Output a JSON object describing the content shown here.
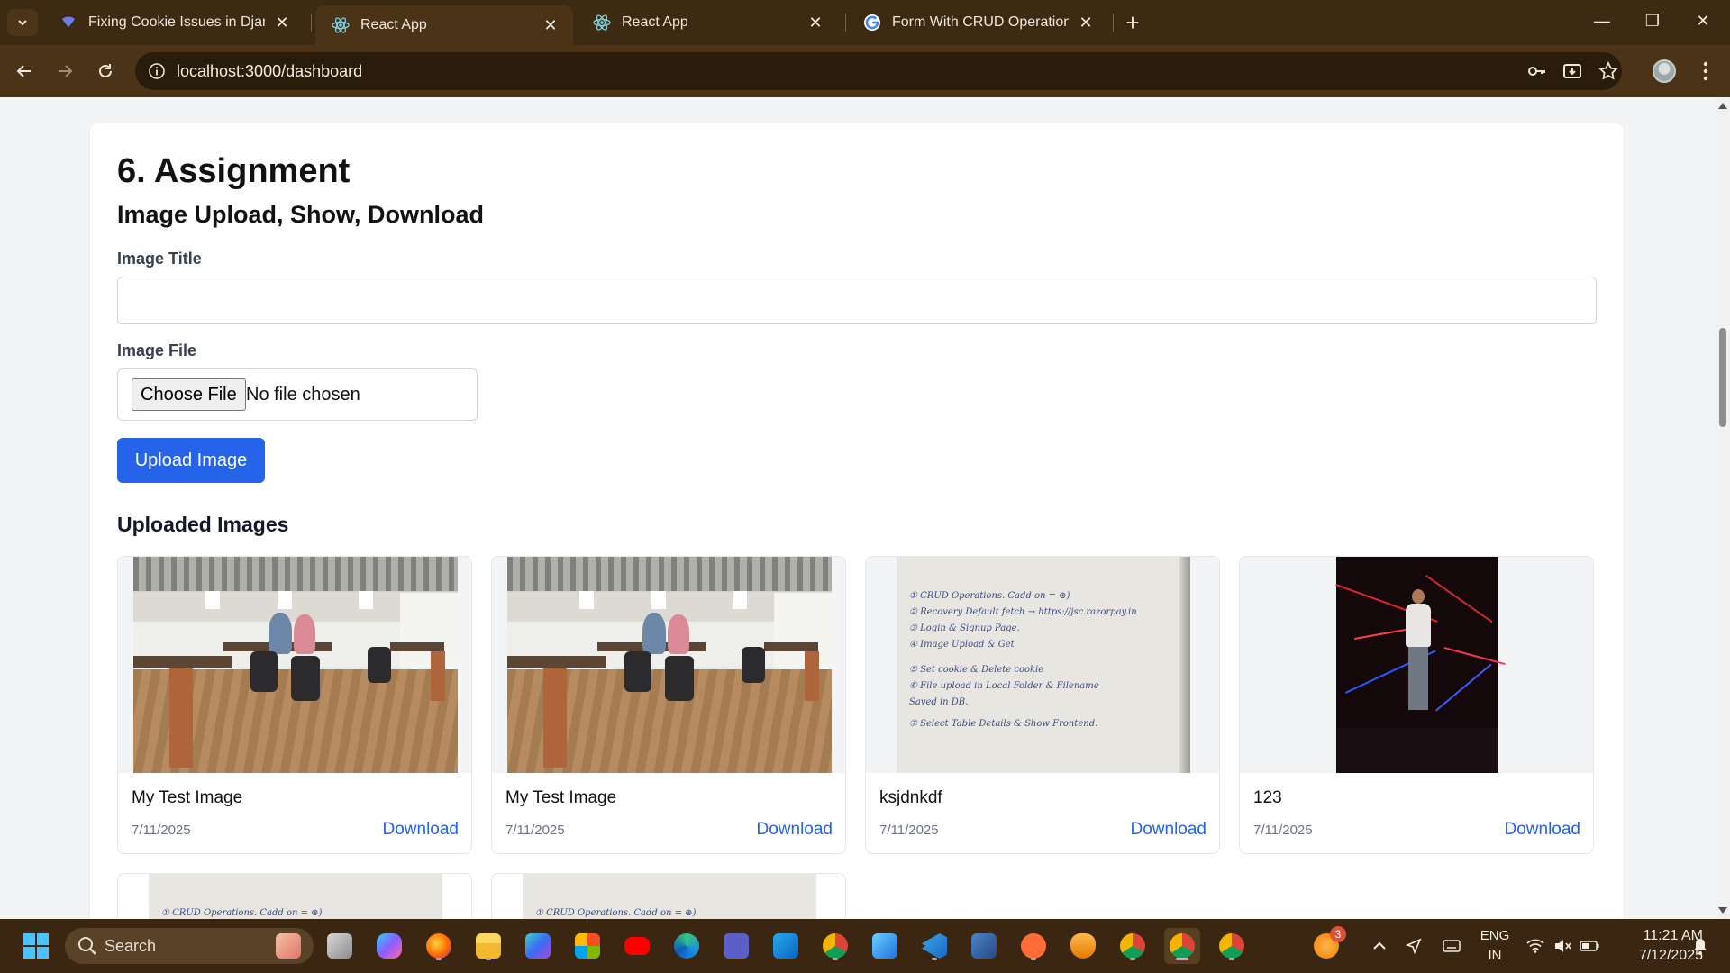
{
  "browser": {
    "tabs": [
      {
        "title": "Fixing Cookie Issues in Django",
        "icon": "claude-favicon",
        "active": false
      },
      {
        "title": "React App",
        "icon": "react-favicon",
        "active": true
      },
      {
        "title": "React App",
        "icon": "react-favicon",
        "active": false
      },
      {
        "title": "Form With CRUD Operations - G",
        "icon": "google-favicon",
        "active": false
      }
    ],
    "url": "localhost:3000/dashboard",
    "colors": {
      "frame": "#3d2a12",
      "toolbar": "#4b3317",
      "omnibox": "#2a1c0b"
    }
  },
  "page": {
    "heading": "6. Assignment",
    "subheading": "Image Upload, Show, Download",
    "title_label": "Image Title",
    "title_value": "",
    "file_label": "Image File",
    "choose_file_label": "Choose File",
    "no_file_text": "No file chosen",
    "upload_button": "Upload Image",
    "uploaded_heading": "Uploaded Images",
    "images": [
      {
        "title": "My Test Image",
        "date": "7/11/2025",
        "download": "Download",
        "thumbnail": "office-photo"
      },
      {
        "title": "My Test Image",
        "date": "7/11/2025",
        "download": "Download",
        "thumbnail": "office-photo"
      },
      {
        "title": "ksjdnkdf",
        "date": "7/11/2025",
        "download": "Download",
        "thumbnail": "notebook-photo"
      },
      {
        "title": "123",
        "date": "7/11/2025",
        "download": "Download",
        "thumbnail": "party-photo"
      }
    ],
    "partial_thumbnails": [
      "notebook-photo",
      "notebook-photo"
    ],
    "notebook_lines": [
      "① CRUD Operations. Cadd on = ⊛)",
      "② Recovery Default fetch → https://jsc.razorpay.in",
      "③ Login & Signup Page.",
      "④ Image Upload & Get",
      "⑤ Set cookie & Delete cookie",
      "⑥ File upload in Local Folder & Filename",
      "   Saved in DB.",
      "⑦ Select Table Details & Show Frontend."
    ],
    "colors": {
      "primary": "#2563eb",
      "link": "#2563eb",
      "card_bg": "#ffffff",
      "page_bg": "#f3f4f6"
    }
  },
  "taskbar": {
    "search_placeholder": "Search",
    "tray": {
      "lang_top": "ENG",
      "lang_bottom": "IN",
      "time": "11:21 AM",
      "date": "7/12/2025",
      "notification_count": "3"
    }
  }
}
